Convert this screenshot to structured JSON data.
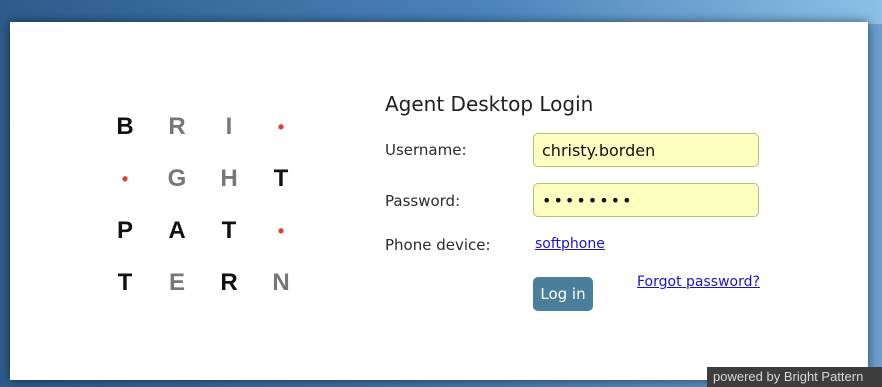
{
  "logo": {
    "rows": [
      [
        {
          "t": "B",
          "c": "#111111"
        },
        {
          "t": "R",
          "c": "#777777"
        },
        {
          "t": "I",
          "c": "#777777"
        },
        {
          "t": "•",
          "c": "#e03c31"
        }
      ],
      [
        {
          "t": "•",
          "c": "#e03c31"
        },
        {
          "t": "G",
          "c": "#777777"
        },
        {
          "t": "H",
          "c": "#777777"
        },
        {
          "t": "T",
          "c": "#111111"
        }
      ],
      [
        {
          "t": "P",
          "c": "#111111"
        },
        {
          "t": "A",
          "c": "#111111"
        },
        {
          "t": "T",
          "c": "#111111"
        },
        {
          "t": "•",
          "c": "#e03c31"
        }
      ],
      [
        {
          "t": "T",
          "c": "#111111"
        },
        {
          "t": "E",
          "c": "#777777"
        },
        {
          "t": "R",
          "c": "#111111"
        },
        {
          "t": "N",
          "c": "#777777"
        }
      ]
    ]
  },
  "form": {
    "title": "Agent Desktop Login",
    "username_label": "Username:",
    "username_value": "christy.borden",
    "password_label": "Password:",
    "password_value": "••••••••",
    "phone_label": "Phone device:",
    "phone_link": "softphone",
    "login_button": "Log in",
    "forgot_link": "Forgot password?"
  },
  "footer": {
    "text": "powered by Bright Pattern"
  },
  "colors": {
    "accent_dot": "#e03c31",
    "button": "#4a7f9c",
    "field_bg": "#fbffc0",
    "link": "#1a14c4"
  }
}
